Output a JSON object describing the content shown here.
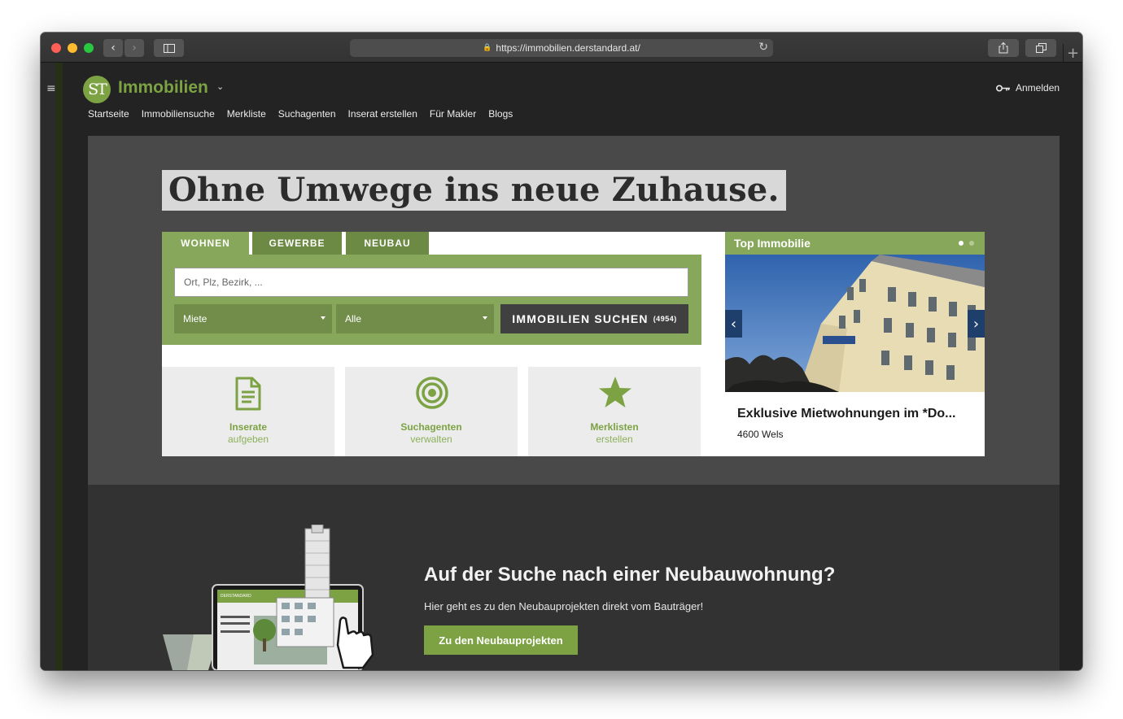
{
  "browser": {
    "url": "https://immobilien.derstandard.at/",
    "back_icon": "chevron-left-icon",
    "forward_icon": "chevron-right-icon",
    "sidebar_icon": "sidebar-icon",
    "share_icon": "share-icon",
    "tabs_icon": "tabs-icon",
    "new_tab_label": "+",
    "reload_icon": "reload-icon",
    "lock_icon": "lock-icon"
  },
  "header": {
    "logo_mark": "ST",
    "logo_text": "Immobilien",
    "logo_chevron": "⌄",
    "login_label": "Anmelden",
    "menu_icon": "hamburger-icon"
  },
  "nav": {
    "items": [
      "Startseite",
      "Immobiliensuche",
      "Merkliste",
      "Suchagenten",
      "Inserat erstellen",
      "Für Makler",
      "Blogs"
    ]
  },
  "hero": {
    "headline": "Ohne Umwege ins neue Zuhause."
  },
  "search": {
    "tabs": [
      "WOHNEN",
      "GEWERBE",
      "NEUBAU"
    ],
    "active_tab": "WOHNEN",
    "placeholder": "Ort, Plz, Bezirk, ...",
    "type_select": "Miete",
    "category_select": "Alle",
    "button_label": "IMMOBILIEN SUCHEN",
    "button_count": "(4954)"
  },
  "tiles": [
    {
      "label": "Inserate",
      "sub": "aufgeben",
      "icon": "document-icon"
    },
    {
      "label": "Suchagenten",
      "sub": "verwalten",
      "icon": "target-icon"
    },
    {
      "label": "Merklisten",
      "sub": "erstellen",
      "icon": "star-icon"
    }
  ],
  "top_immobilie": {
    "heading": "Top Immobilie",
    "title": "Exklusive Mietwohnungen im *Do...",
    "location": "4600 Wels",
    "prev_label": "‹",
    "next_label": "›",
    "slide_count": 2,
    "active_slide": 1
  },
  "promo": {
    "title": "Auf der Suche nach einer Neubauwohnung?",
    "subtitle": "Hier geht es zu den Neubauprojekten direkt vom Bauträger!",
    "button_label": "Zu den Neubauprojekten",
    "illustration_text": "DERSTANDARD"
  },
  "colors": {
    "brand_green": "#7ca243",
    "tab_green": "#87a85a",
    "dark_bg": "#232323",
    "hero_bg": "#494949",
    "slider_arrow": "#1e3e6c"
  }
}
